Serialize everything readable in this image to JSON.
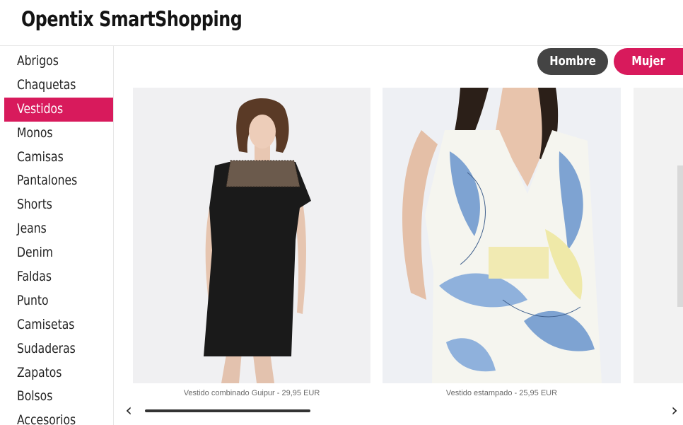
{
  "app": {
    "title": "Opentix SmartShopping"
  },
  "sidebar": {
    "items": [
      {
        "label": "Abrigos",
        "active": false
      },
      {
        "label": "Chaquetas",
        "active": false
      },
      {
        "label": "Vestidos",
        "active": true
      },
      {
        "label": "Monos",
        "active": false
      },
      {
        "label": "Camisas",
        "active": false
      },
      {
        "label": "Pantalones",
        "active": false
      },
      {
        "label": "Shorts",
        "active": false
      },
      {
        "label": "Jeans",
        "active": false
      },
      {
        "label": "Denim",
        "active": false
      },
      {
        "label": "Faldas",
        "active": false
      },
      {
        "label": "Punto",
        "active": false
      },
      {
        "label": "Camisetas",
        "active": false
      },
      {
        "label": "Sudaderas",
        "active": false
      },
      {
        "label": "Zapatos",
        "active": false
      },
      {
        "label": "Bolsos",
        "active": false
      },
      {
        "label": "Accesorios",
        "active": false
      }
    ]
  },
  "gender": {
    "hombre_label": "Hombre",
    "mujer_label": "Mujer",
    "selected": "Mujer"
  },
  "products": [
    {
      "caption": "Vestido combinado Guipur - 29,95 EUR"
    },
    {
      "caption": "Vestido estampado - 25,95 EUR"
    }
  ],
  "carousel": {
    "prev_icon": "chevron-left-icon",
    "next_icon": "chevron-right-icon",
    "prev_glyph": "‹",
    "next_glyph": "›",
    "scroll_fraction": 0.32
  },
  "colors": {
    "accent": "#d81a5c",
    "dark_button": "#444444"
  }
}
